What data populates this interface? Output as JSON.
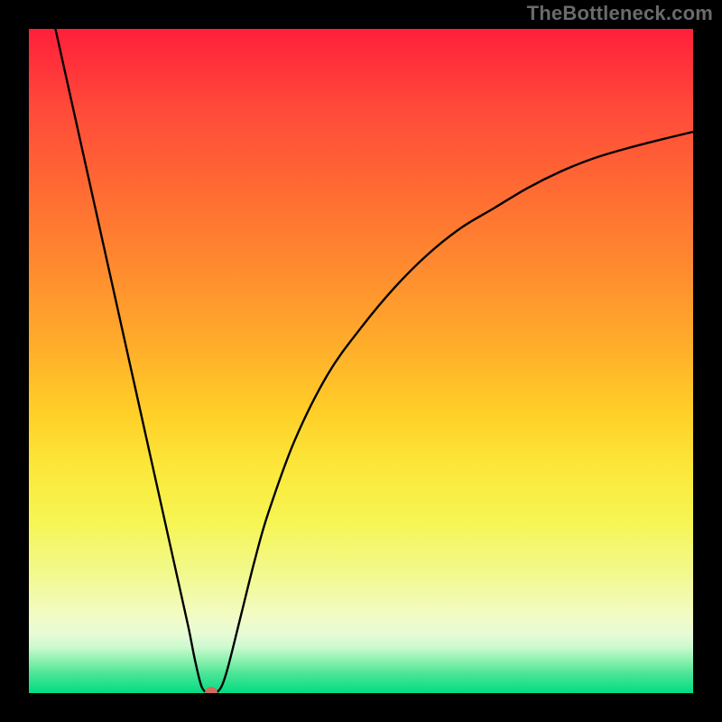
{
  "watermark": "TheBottleneck.com",
  "chart_data": {
    "type": "line",
    "title": "",
    "xlabel": "",
    "ylabel": "",
    "xlim": [
      0,
      100
    ],
    "ylim": [
      0,
      100
    ],
    "grid": false,
    "series": [
      {
        "name": "curve",
        "x": [
          4,
          6,
          8,
          10,
          12,
          14,
          16,
          18,
          20,
          22,
          24,
          25,
          26,
          27,
          28,
          29,
          30,
          32,
          34,
          36,
          40,
          45,
          50,
          55,
          60,
          65,
          70,
          75,
          80,
          85,
          90,
          95,
          100
        ],
        "y": [
          100,
          91,
          82,
          73,
          64,
          55,
          46,
          37,
          28,
          19,
          10,
          5,
          1,
          0,
          0,
          1,
          4,
          12,
          20,
          27,
          38,
          48,
          55,
          61,
          66,
          70,
          73,
          76,
          78.5,
          80.5,
          82,
          83.3,
          84.5
        ]
      }
    ],
    "marker": {
      "x": 27.5,
      "y": 0
    },
    "background_gradient": {
      "top_color": "#ff1f3a",
      "mid_color": "#ffd028",
      "bottom_color": "#00dc82"
    }
  }
}
